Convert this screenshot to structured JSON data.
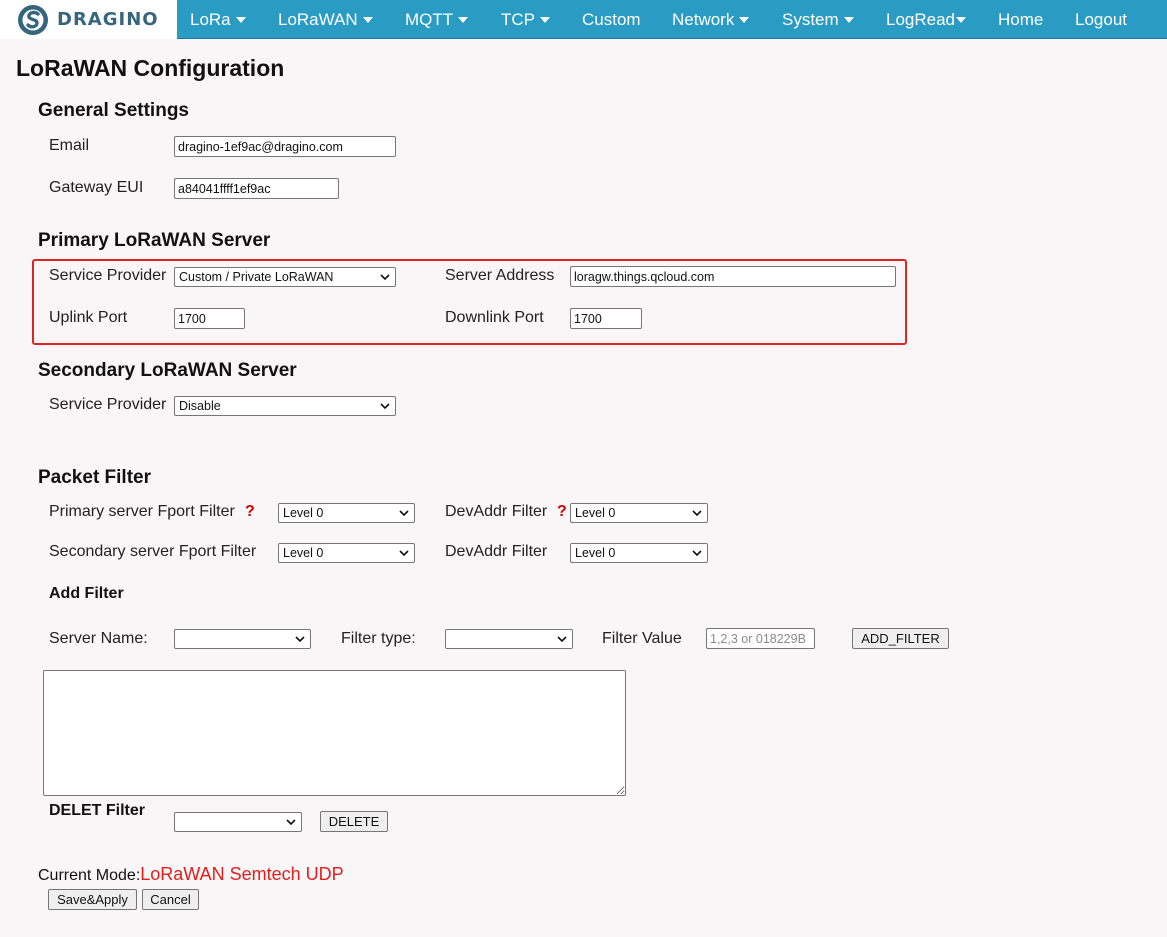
{
  "nav": {
    "brand": "DRAGINO",
    "items": [
      {
        "label": "LoRa",
        "dropdown": true
      },
      {
        "label": "LoRaWAN",
        "dropdown": true
      },
      {
        "label": "MQTT",
        "dropdown": true
      },
      {
        "label": "TCP",
        "dropdown": true
      },
      {
        "label": "Custom",
        "dropdown": false
      },
      {
        "label": "Network",
        "dropdown": true
      },
      {
        "label": "System",
        "dropdown": true
      },
      {
        "label": "LogRead",
        "dropdown": true
      },
      {
        "label": "Home",
        "dropdown": false
      },
      {
        "label": "Logout",
        "dropdown": false
      }
    ],
    "colors": {
      "bar": "#2a9cc4",
      "brand_text": "#35657f"
    }
  },
  "page_title": "LoRaWAN Configuration",
  "general": {
    "title": "General Settings",
    "email_label": "Email",
    "email_value": "dragino-1ef9ac@dragino.com",
    "eui_label": "Gateway EUI",
    "eui_value": "a84041ffff1ef9ac"
  },
  "primary": {
    "title": "Primary LoRaWAN Server",
    "provider_label": "Service Provider",
    "provider_value": "Custom / Private LoRaWAN",
    "address_label": "Server Address",
    "address_value": "loragw.things.qcloud.com",
    "uplink_label": "Uplink Port",
    "uplink_value": "1700",
    "downlink_label": "Downlink Port",
    "downlink_value": "1700",
    "highlight_color": "#e02424"
  },
  "secondary": {
    "title": "Secondary LoRaWAN Server",
    "provider_label": "Service Provider",
    "provider_value": "Disable"
  },
  "filter": {
    "title": "Packet Filter",
    "primary_fport_label": "Primary server Fport Filter",
    "primary_fport_value": "Level 0",
    "devaddr_label": "DevAddr Filter",
    "primary_devaddr_value": "Level 0",
    "secondary_fport_label": "Secondary server Fport Filter",
    "secondary_fport_value": "Level 0",
    "secondary_devaddr_value": "Level 0",
    "help_mark": "?",
    "add_filter_label": "Add Filter",
    "server_name_label": "Server Name:",
    "server_name_value": "",
    "filter_type_label": "Filter type:",
    "filter_type_value": "",
    "filter_value_label": "Filter Value",
    "filter_value_placeholder": "1,2,3 or 018229B",
    "add_button": "ADD_FILTER",
    "delete_label": "DELET Filter",
    "delete_select_value": "",
    "delete_button": "DELETE"
  },
  "mode": {
    "label": "Current Mode:",
    "value": "LoRaWAN Semtech UDP",
    "value_color": "#e81c1c"
  },
  "actions": {
    "save": "Save&Apply",
    "cancel": "Cancel"
  }
}
